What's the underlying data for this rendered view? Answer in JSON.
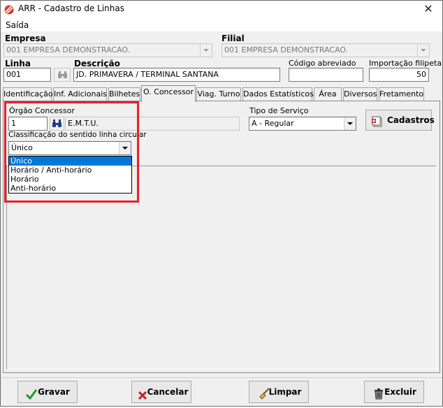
{
  "window": {
    "title": "ARR - Cadastro de Linhas",
    "close_symbol": "✕"
  },
  "menu": {
    "saida": "Saída"
  },
  "empresa": {
    "label": "Empresa",
    "value": "001 EMPRESA DEMONSTRACAO."
  },
  "filial": {
    "label": "Filial",
    "value": "001 EMPRESA DEMONSTRACAO."
  },
  "linha": {
    "label": "Linha",
    "value": "001"
  },
  "descricao": {
    "label": "Descrição",
    "value": "JD. PRIMAVERA / TERMINAL SANTANA"
  },
  "codigo_abreviado": {
    "label": "Código abreviado",
    "value": ""
  },
  "importacao_filipeta": {
    "label": "Importação filipeta",
    "value": "50"
  },
  "tabs": [
    "Identificação",
    "Inf. Adicionais",
    "Bilhetes",
    "O. Concessor",
    "Viag. Turno",
    "Dados Estatísticos",
    "Área",
    "Diversos",
    "Fretamento"
  ],
  "orgao": {
    "label": "Órgão Concessor",
    "code": "1",
    "name": "E.M.T.U."
  },
  "tipo_servico": {
    "label": "Tipo de Serviço",
    "value": "A - Regular"
  },
  "cadastros_button": "Cadastros",
  "classificacao": {
    "label": "Classificação do sentido linha circular",
    "value": "Único",
    "options": [
      "Único",
      "Horário / Anti-horário",
      "Horário",
      "Anti-horário"
    ]
  },
  "footer": {
    "gravar": "Gravar",
    "cancelar": "Cancelar",
    "limpar": "Limpar",
    "excluir": "Excluir"
  },
  "colors": {
    "highlight": "#e8202a",
    "selection": "#0078d7",
    "accent_logo": "#d93a2b"
  },
  "icons": [
    "app-logo-icon",
    "close-icon",
    "binoculars-icon",
    "cadastros-icon",
    "check-icon",
    "x-icon",
    "broom-icon",
    "trash-icon"
  ]
}
